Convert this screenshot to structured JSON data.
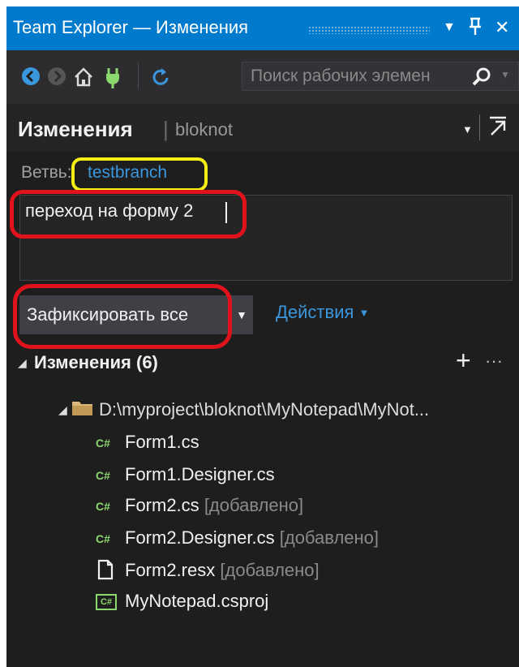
{
  "titlebar": {
    "title": "Team Explorer — Изменения",
    "dropdown_icon": "caret-down-icon",
    "pin_icon": "pin-icon",
    "close_icon": "close-icon"
  },
  "toolbar": {
    "icons": [
      "back-icon",
      "forward-icon",
      "home-icon",
      "connect-icon",
      "refresh-icon"
    ],
    "search_placeholder": "Поиск рабочих элемен",
    "search_icon": "search-icon"
  },
  "header": {
    "title": "Изменения",
    "separator": "|",
    "repo": "bloknot"
  },
  "branch": {
    "label": "Ветвь:",
    "name": "testbranch"
  },
  "commit_message": "переход на форму 2",
  "commit_button": "Зафиксировать все",
  "actions_label": "Действия",
  "changes": {
    "header": "Изменения (6)",
    "folder": "D:\\myproject\\bloknot\\MyNotepad\\MyNot...",
    "files": [
      {
        "name": "Form1.cs",
        "status": "",
        "icon": "csharp-file-icon"
      },
      {
        "name": "Form1.Designer.cs",
        "status": "",
        "icon": "csharp-file-icon"
      },
      {
        "name": "Form2.cs",
        "status": "[добавлено]",
        "icon": "csharp-file-icon"
      },
      {
        "name": "Form2.Designer.cs",
        "status": "[добавлено]",
        "icon": "csharp-file-icon"
      },
      {
        "name": "Form2.resx",
        "status": "[добавлено]",
        "icon": "resource-file-icon"
      },
      {
        "name": "MyNotepad.csproj",
        "status": "",
        "icon": "csharp-project-icon"
      }
    ]
  },
  "colors": {
    "accent": "#007acc",
    "annotation_red": "#e0131d",
    "annotation_yellow": "#f7ee15",
    "link": "#3a96dd"
  }
}
